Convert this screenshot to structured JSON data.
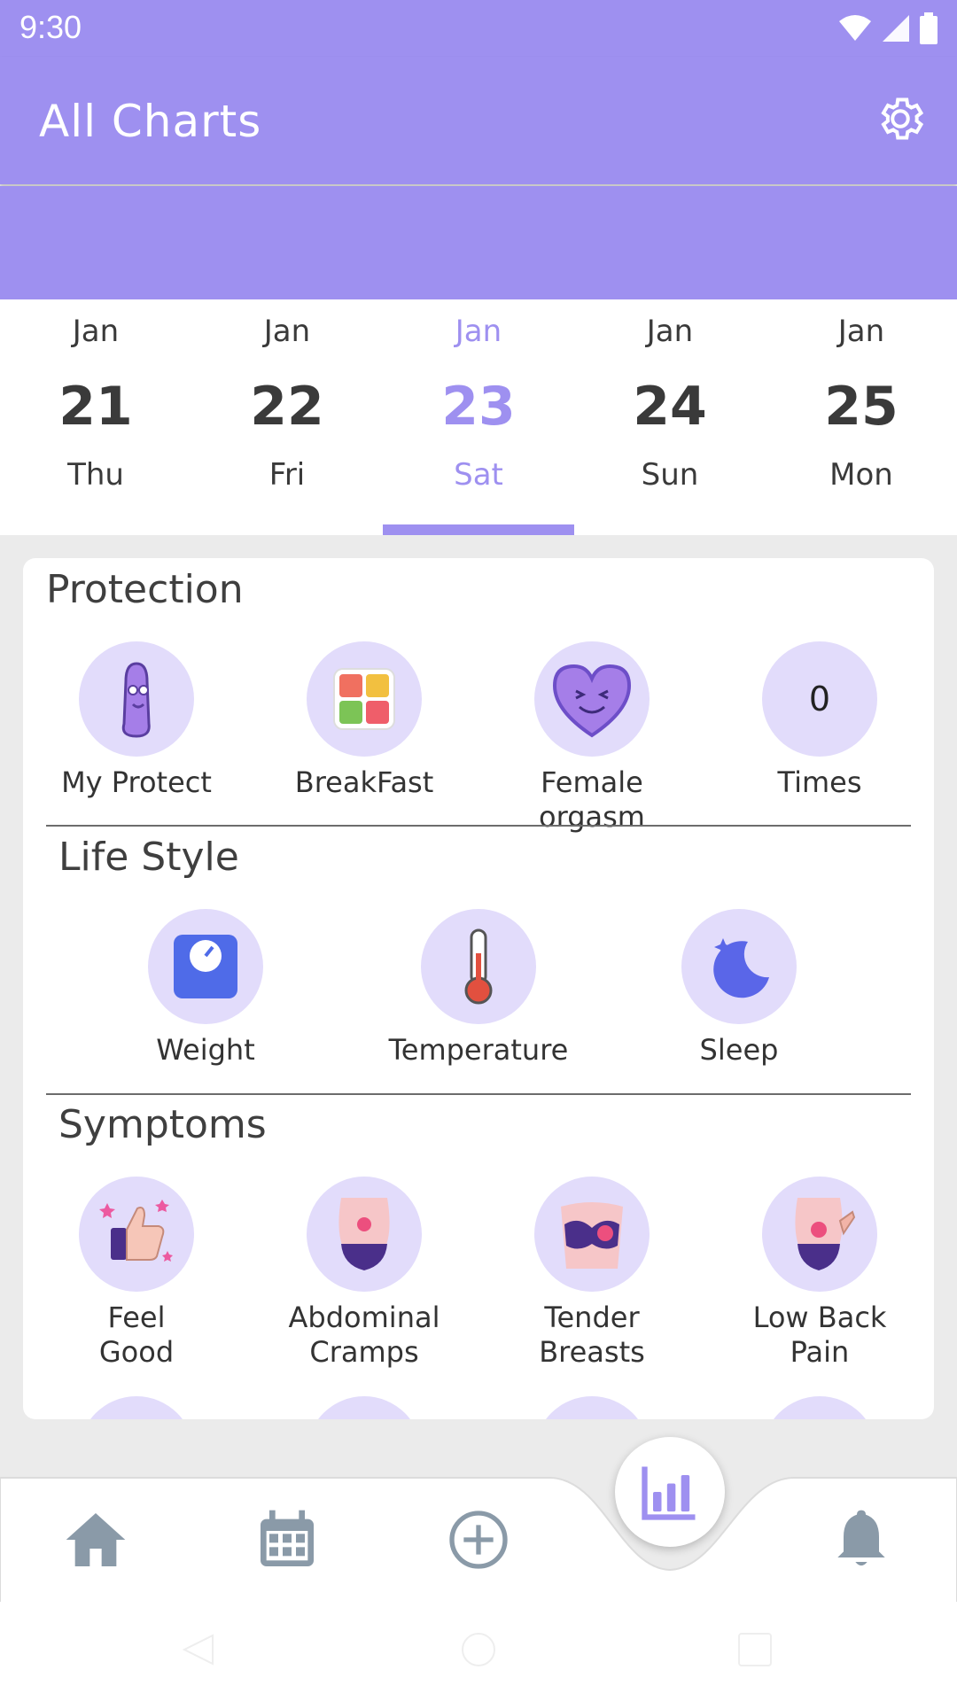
{
  "status": {
    "time": "9:30"
  },
  "app_bar": {
    "title": "All Charts"
  },
  "dates": [
    {
      "month": "Jan",
      "day": "21",
      "weekday": "Thu",
      "selected": false
    },
    {
      "month": "Jan",
      "day": "22",
      "weekday": "Fri",
      "selected": false
    },
    {
      "month": "Jan",
      "day": "23",
      "weekday": "Sat",
      "selected": true
    },
    {
      "month": "Jan",
      "day": "24",
      "weekday": "Sun",
      "selected": false
    },
    {
      "month": "Jan",
      "day": "25",
      "weekday": "Mon",
      "selected": false
    }
  ],
  "sections": {
    "protection": {
      "title": "Protection",
      "items": [
        {
          "label": "My Protect",
          "icon": "condom-mascot-icon"
        },
        {
          "label": "BreakFast",
          "icon": "breakfast-icon"
        },
        {
          "label": "Female orgasm",
          "icon": "heart-face-icon"
        },
        {
          "label": "Times",
          "icon": "counter",
          "value": "0"
        }
      ]
    },
    "lifestyle": {
      "title": "Life Style",
      "items": [
        {
          "label": "Weight",
          "icon": "scale-icon"
        },
        {
          "label": "Temperature",
          "icon": "thermometer-icon"
        },
        {
          "label": "Sleep",
          "icon": "moon-icon"
        }
      ]
    },
    "symptoms": {
      "title": "Symptoms",
      "items": [
        {
          "label": "Feel\nGood",
          "icon": "thumbs-up-icon"
        },
        {
          "label": "Abdominal\nCramps",
          "icon": "abdomen-icon"
        },
        {
          "label": "Tender\nBreasts",
          "icon": "breast-icon"
        },
        {
          "label": "Low Back\nPain",
          "icon": "back-pain-icon"
        }
      ]
    }
  },
  "bottom_nav": [
    "home-icon",
    "calendar-icon",
    "add-icon",
    "charts-icon",
    "bell-icon"
  ],
  "colors": {
    "primary": "#9e90f0",
    "icon_bg": "#e2dcfb",
    "nav_icon": "#8a9aa8"
  }
}
